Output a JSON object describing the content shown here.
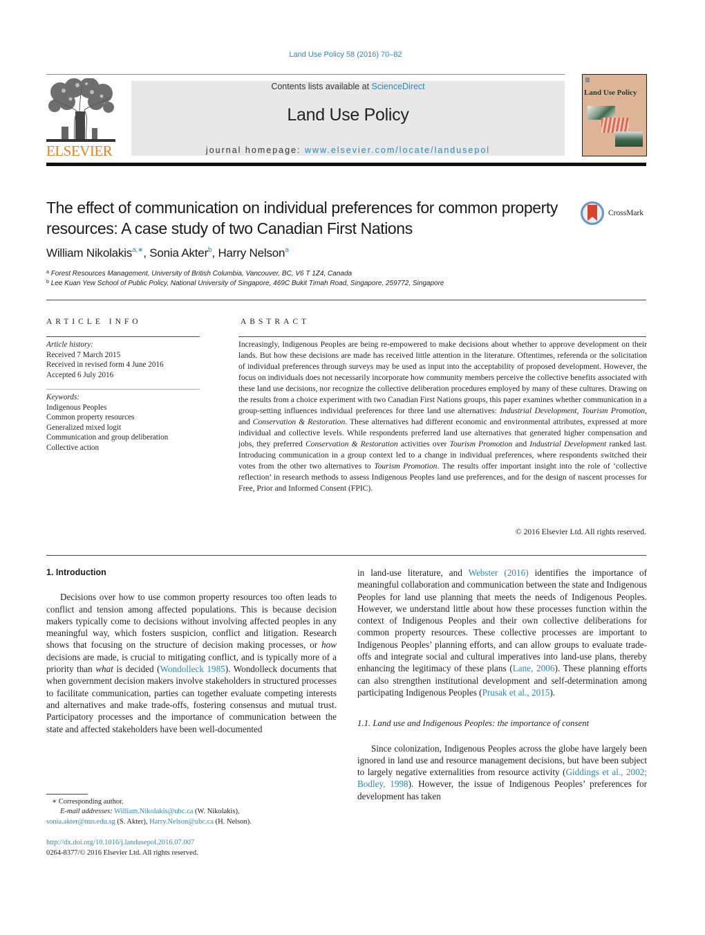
{
  "header": {
    "citation": "Land Use Policy 58 (2016) 70–82",
    "contents_prefix": "Contents lists available at ",
    "contents_link": "ScienceDirect",
    "journal_title": "Land Use Policy",
    "homepage_prefix": "journal homepage: ",
    "homepage_link": "www.elsevier.com/locate/landusepol",
    "publisher_logo_text": "ELSEVIER",
    "cover_title": "Land Use Policy"
  },
  "colors": {
    "link": "#2a8ab5",
    "elsevier_orange": "#f07f1d",
    "banner_gray": "#e8e8e8",
    "cover_tan": "#ddb596"
  },
  "article": {
    "title": "The effect of communication on individual preferences for common property resources: A case study of two Canadian First Nations",
    "crossmark_label": "CrossMark",
    "authors": [
      {
        "name": "William Nikolakis",
        "sup": "a,∗"
      },
      {
        "name": "Sonia Akter",
        "sup": "b"
      },
      {
        "name": "Harry Nelson",
        "sup": "a"
      }
    ],
    "affiliations": [
      {
        "mark": "a",
        "text": "Forest Resources Management, University of British Columbia, Vancouver, BC, V6 T 1Z4, Canada"
      },
      {
        "mark": "b",
        "text": "Lee Kuan Yew School of Public Policy, National University of Singapore, 469C Bukit Timah Road, Singapore, 259772, Singapore"
      }
    ]
  },
  "article_info": {
    "heading": "ARTICLE INFO",
    "history_label": "Article history:",
    "history": [
      "Received 7 March 2015",
      "Received in revised form 4 June 2016",
      "Accepted 6 July 2016"
    ],
    "keywords_label": "Keywords:",
    "keywords": [
      "Indigenous Peoples",
      "Common property resources",
      "Generalized mixed logit",
      "Communication and group deliberation",
      "Collective action"
    ]
  },
  "abstract": {
    "heading": "ABSTRACT",
    "segments": [
      {
        "t": "Increasingly, Indigenous Peoples are being re-empowered to make decisions about whether to approve development on their lands. But how these decisions are made has received little attention in the liter­ature. Oftentimes, referenda or the solicitation of individual preferences through surveys may be used as input into the acceptability of proposed development. However, the focus on individuals does not necessarily incorporate how community members perceive the collective benefits associated with these land use decisions, nor recognize the collective deliberation procedures employed by many of these cul­tures. Drawing on the results from a choice experiment with two Canadian First Nations groups, this paper examines whether communication in a group-setting influences individual preferences for three land use alternatives: "
      },
      {
        "t": "Industrial Development",
        "i": true
      },
      {
        "t": ", "
      },
      {
        "t": "Tourism Promotion",
        "i": true
      },
      {
        "t": ", and "
      },
      {
        "t": "Conservation & Restoration",
        "i": true
      },
      {
        "t": ". These alternatives had different economic and environmental attributes, expressed at more individual and col­lective levels. While respondents preferred land use alternatives that generated higher compensation and jobs, they preferred "
      },
      {
        "t": "Conservation & Restoration",
        "i": true
      },
      {
        "t": " activities over "
      },
      {
        "t": "Tourism Promotion",
        "i": true
      },
      {
        "t": " and "
      },
      {
        "t": "Industrial Develop­ment",
        "i": true
      },
      {
        "t": " ranked last. Introducing communication in a group context led to a change in individual preferences, where respondents switched their votes from the other two alternatives to "
      },
      {
        "t": "Tourism Promotion",
        "i": true
      },
      {
        "t": ". The results offer important insight into the role of ‘collective reflection’ in research methods to assess Indigenous Peoples land use preferences, and for the design of nascent processes for Free, Prior and Informed Consent (FPIC)."
      }
    ],
    "copyright": "© 2016 Elsevier Ltd. All rights reserved."
  },
  "body": {
    "section1_heading": "1.  Introduction",
    "section1_para1": [
      {
        "t": "Decisions over how to use common property resources too often leads to conflict and tension among affected populations. This is because decision makers typically come to decisions without involving affected peoples in any meaningful way, which fosters suspicion, conflict and litigation. Research shows that focusing on the structure of decision making processes, or "
      },
      {
        "t": "how",
        "i": true
      },
      {
        "t": " decisions are made, is crucial to mitigating conflict, and is typically more of a priority than "
      },
      {
        "t": "what",
        "i": true
      },
      {
        "t": " is decided ("
      },
      {
        "t": "Wondolleck 1985",
        "link": true
      },
      {
        "t": "). Wondol­leck documents that when government decision makers involve stakeholders in structured processes to facilitate communication, parties can together evaluate competing interests and alternatives and make trade-offs, fostering consensus and mutual trust. Partic­ipatory processes and the importance of communication between the state and affected stakeholders have been well-documented"
      }
    ],
    "right_para1": [
      {
        "t": "in land-use literature, and "
      },
      {
        "t": "Webster (2016)",
        "link": true
      },
      {
        "t": " identifies the impor­tance of meaningful collaboration and communication between the state and Indigenous Peoples for land use planning that meets the needs of Indigenous Peoples. However, we understand little about how these processes function within the context of Indige­nous Peoples and their own collective deliberations for common property resources. These collective processes are important to Indigenous Peoples’ planning efforts, and can allow groups to eval­uate trade-offs and integrate social and cultural imperatives into land-use plans, thereby enhancing the legitimacy of these plans ("
      },
      {
        "t": "Lane, 2006",
        "link": true
      },
      {
        "t": "). These planning efforts can also strengthen institu­tional development and self-determination among participating Indigenous Peoples ("
      },
      {
        "t": "Prusak et al., 2015",
        "link": true
      },
      {
        "t": ")."
      }
    ],
    "subsection_heading": "1.1.  Land use and Indigenous Peoples: the importance of consent",
    "right_para2": [
      {
        "t": "Since colonization, Indigenous Peoples across the globe have largely been ignored in land use and resource management deci­sions, but have been subject to largely negative externalities from resource activity ("
      },
      {
        "t": "Giddings et al., 2002; Bodley, 1998",
        "link": true
      },
      {
        "t": "). However, the issue of Indigenous Peoples’ preferences for development has taken"
      }
    ]
  },
  "footnotes": {
    "corresponding": "∗  Corresponding author.",
    "email_label": "E-mail addresses:",
    "emails": [
      {
        "addr": "William.Nikolakis@ubc.ca",
        "who": " (W. Nikolakis),"
      },
      {
        "addr": "sonia.akter@nus.edu.sg",
        "who": " (S. Akter), "
      },
      {
        "addr": "Harry.Nelson@ubc.ca",
        "who": " (H. Nelson)."
      }
    ],
    "doi": "http://dx.doi.org/10.1016/j.landusepol.2016.07.007",
    "issn_copyright": "0264-8377/© 2016 Elsevier Ltd. All rights reserved."
  }
}
